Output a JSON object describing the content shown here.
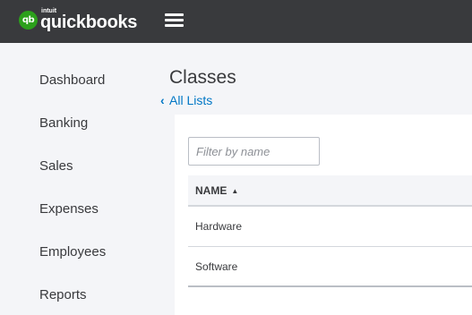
{
  "header": {
    "logo_icon": "qb",
    "brand_small": "intuit",
    "brand": "quickbooks"
  },
  "sidebar": {
    "items": [
      {
        "label": "Dashboard"
      },
      {
        "label": "Banking"
      },
      {
        "label": "Sales"
      },
      {
        "label": "Expenses"
      },
      {
        "label": "Employees"
      },
      {
        "label": "Reports"
      }
    ]
  },
  "main": {
    "title": "Classes",
    "back_link": "All Lists",
    "filter_placeholder": "Filter by name",
    "table": {
      "columns": [
        "NAME"
      ],
      "rows": [
        {
          "name": "Hardware"
        },
        {
          "name": "Software"
        }
      ]
    }
  }
}
